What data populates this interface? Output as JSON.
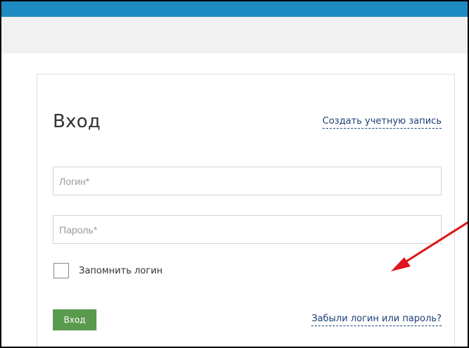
{
  "colors": {
    "top_bar": "#1e8bc3",
    "subheader": "#f1f1f1",
    "button": "#5a9a4e",
    "link": "#1a3e74",
    "annotation_arrow": "#e0141a"
  },
  "login": {
    "title": "Вход",
    "create_account_link": "Создать учетную запись",
    "login_placeholder": "Логин*",
    "password_placeholder": "Пароль*",
    "remember_label": "Запомнить логин",
    "submit_label": "Вход",
    "forgot_link": "Забыли логин или пароль?"
  },
  "annotation": {
    "icon": "arrow-down-left-icon"
  }
}
